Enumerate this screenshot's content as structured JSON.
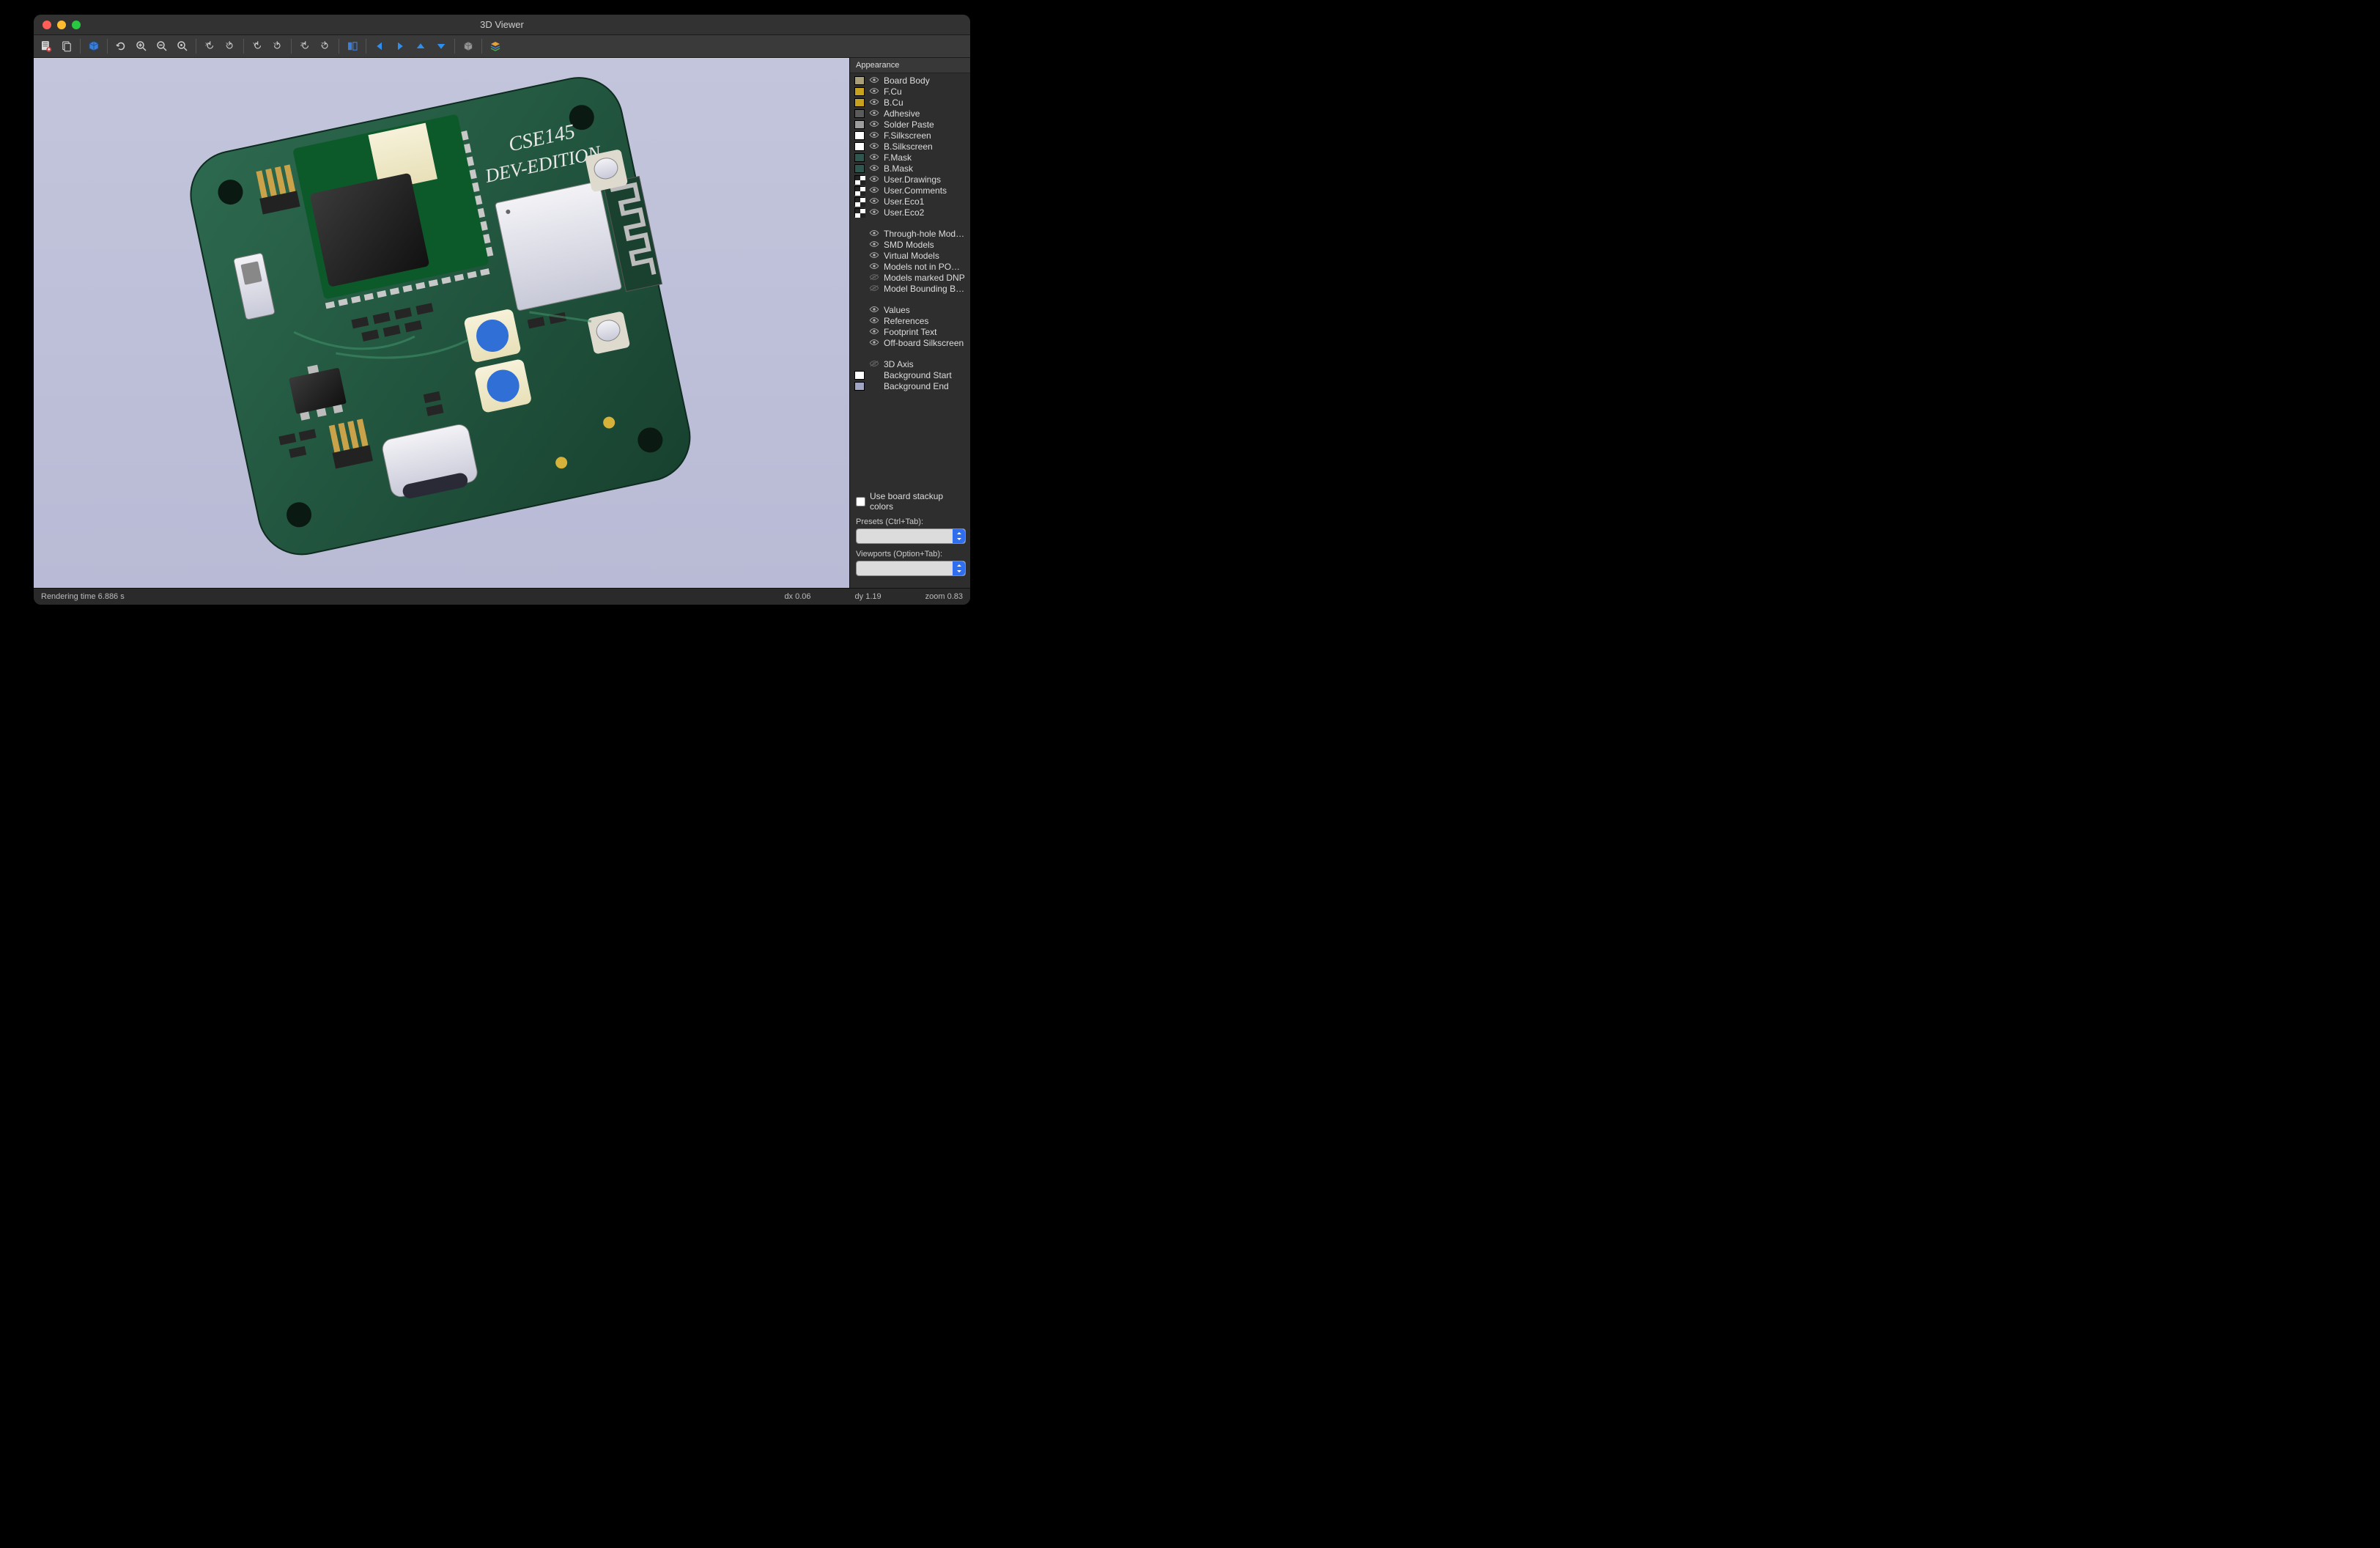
{
  "window": {
    "title": "3D Viewer"
  },
  "sidebar": {
    "panel_title": "Appearance",
    "layers": [
      {
        "label": "Board Body",
        "swatch": "#a9a07a",
        "eye": true,
        "checker": false
      },
      {
        "label": "F.Cu",
        "swatch": "#c7a21f",
        "eye": true,
        "checker": false
      },
      {
        "label": "B.Cu",
        "swatch": "#c7a21f",
        "eye": true,
        "checker": false
      },
      {
        "label": "Adhesive",
        "swatch": "#5b5b5b",
        "eye": true,
        "checker": false
      },
      {
        "label": "Solder Paste",
        "swatch": "#9d9d9d",
        "eye": true,
        "checker": false
      },
      {
        "label": "F.Silkscreen",
        "swatch": "#ffffff",
        "eye": true,
        "checker": false
      },
      {
        "label": "B.Silkscreen",
        "swatch": "#ffffff",
        "eye": true,
        "checker": false
      },
      {
        "label": "F.Mask",
        "swatch": "#2f574f",
        "eye": true,
        "checker": false
      },
      {
        "label": "B.Mask",
        "swatch": "#2f574f",
        "eye": true,
        "checker": false
      },
      {
        "label": "User.Drawings",
        "swatch": "checker",
        "eye": true,
        "checker": true
      },
      {
        "label": "User.Comments",
        "swatch": "checker",
        "eye": true,
        "checker": true
      },
      {
        "label": "User.Eco1",
        "swatch": "checker",
        "eye": true,
        "checker": true
      },
      {
        "label": "User.Eco2",
        "swatch": "checker",
        "eye": true,
        "checker": true
      }
    ],
    "toggles_a": [
      {
        "label": "Through-hole Models",
        "eye": true
      },
      {
        "label": "SMD Models",
        "eye": true
      },
      {
        "label": "Virtual Models",
        "eye": true
      },
      {
        "label": "Models not in POS File",
        "eye": true
      },
      {
        "label": "Models marked DNP",
        "eye": false
      },
      {
        "label": "Model Bounding Boxes",
        "eye": false
      }
    ],
    "toggles_b": [
      {
        "label": "Values",
        "eye": true
      },
      {
        "label": "References",
        "eye": true
      },
      {
        "label": "Footprint Text",
        "eye": true
      },
      {
        "label": "Off-board Silkscreen",
        "eye": true
      }
    ],
    "toggles_c": [
      {
        "label": "3D Axis",
        "eye": false,
        "swatch": null
      },
      {
        "label": "Background Start",
        "eye": null,
        "swatch": "#ffffff"
      },
      {
        "label": "Background End",
        "eye": null,
        "swatch": "#a2a4c4"
      }
    ],
    "stackup_label": "Use board stackup colors",
    "presets_label": "Presets (Ctrl+Tab):",
    "viewports_label": "Viewports (Option+Tab):"
  },
  "board": {
    "line1": "CSE145",
    "line2": "DEV-EDITION"
  },
  "status": {
    "render": "Rendering time 6.886 s",
    "dx": "dx 0.06",
    "dy": "dy 1.19",
    "zoom": "zoom 0.83"
  },
  "toolbar_names": [
    "export-icon",
    "copy-icon",
    "cube-view-icon",
    "refresh-icon",
    "zoom-in-icon",
    "zoom-out-icon",
    "zoom-fit-icon",
    "flip-x-left-icon",
    "flip-x-right-icon",
    "flip-y-up-icon",
    "flip-y-down-icon",
    "flip-z-cw-icon",
    "flip-z-ccw-icon",
    "rotate-icon",
    "pan-left-icon",
    "pan-right-icon",
    "pan-up-icon",
    "pan-down-icon",
    "ortho-icon",
    "layers-icon"
  ]
}
